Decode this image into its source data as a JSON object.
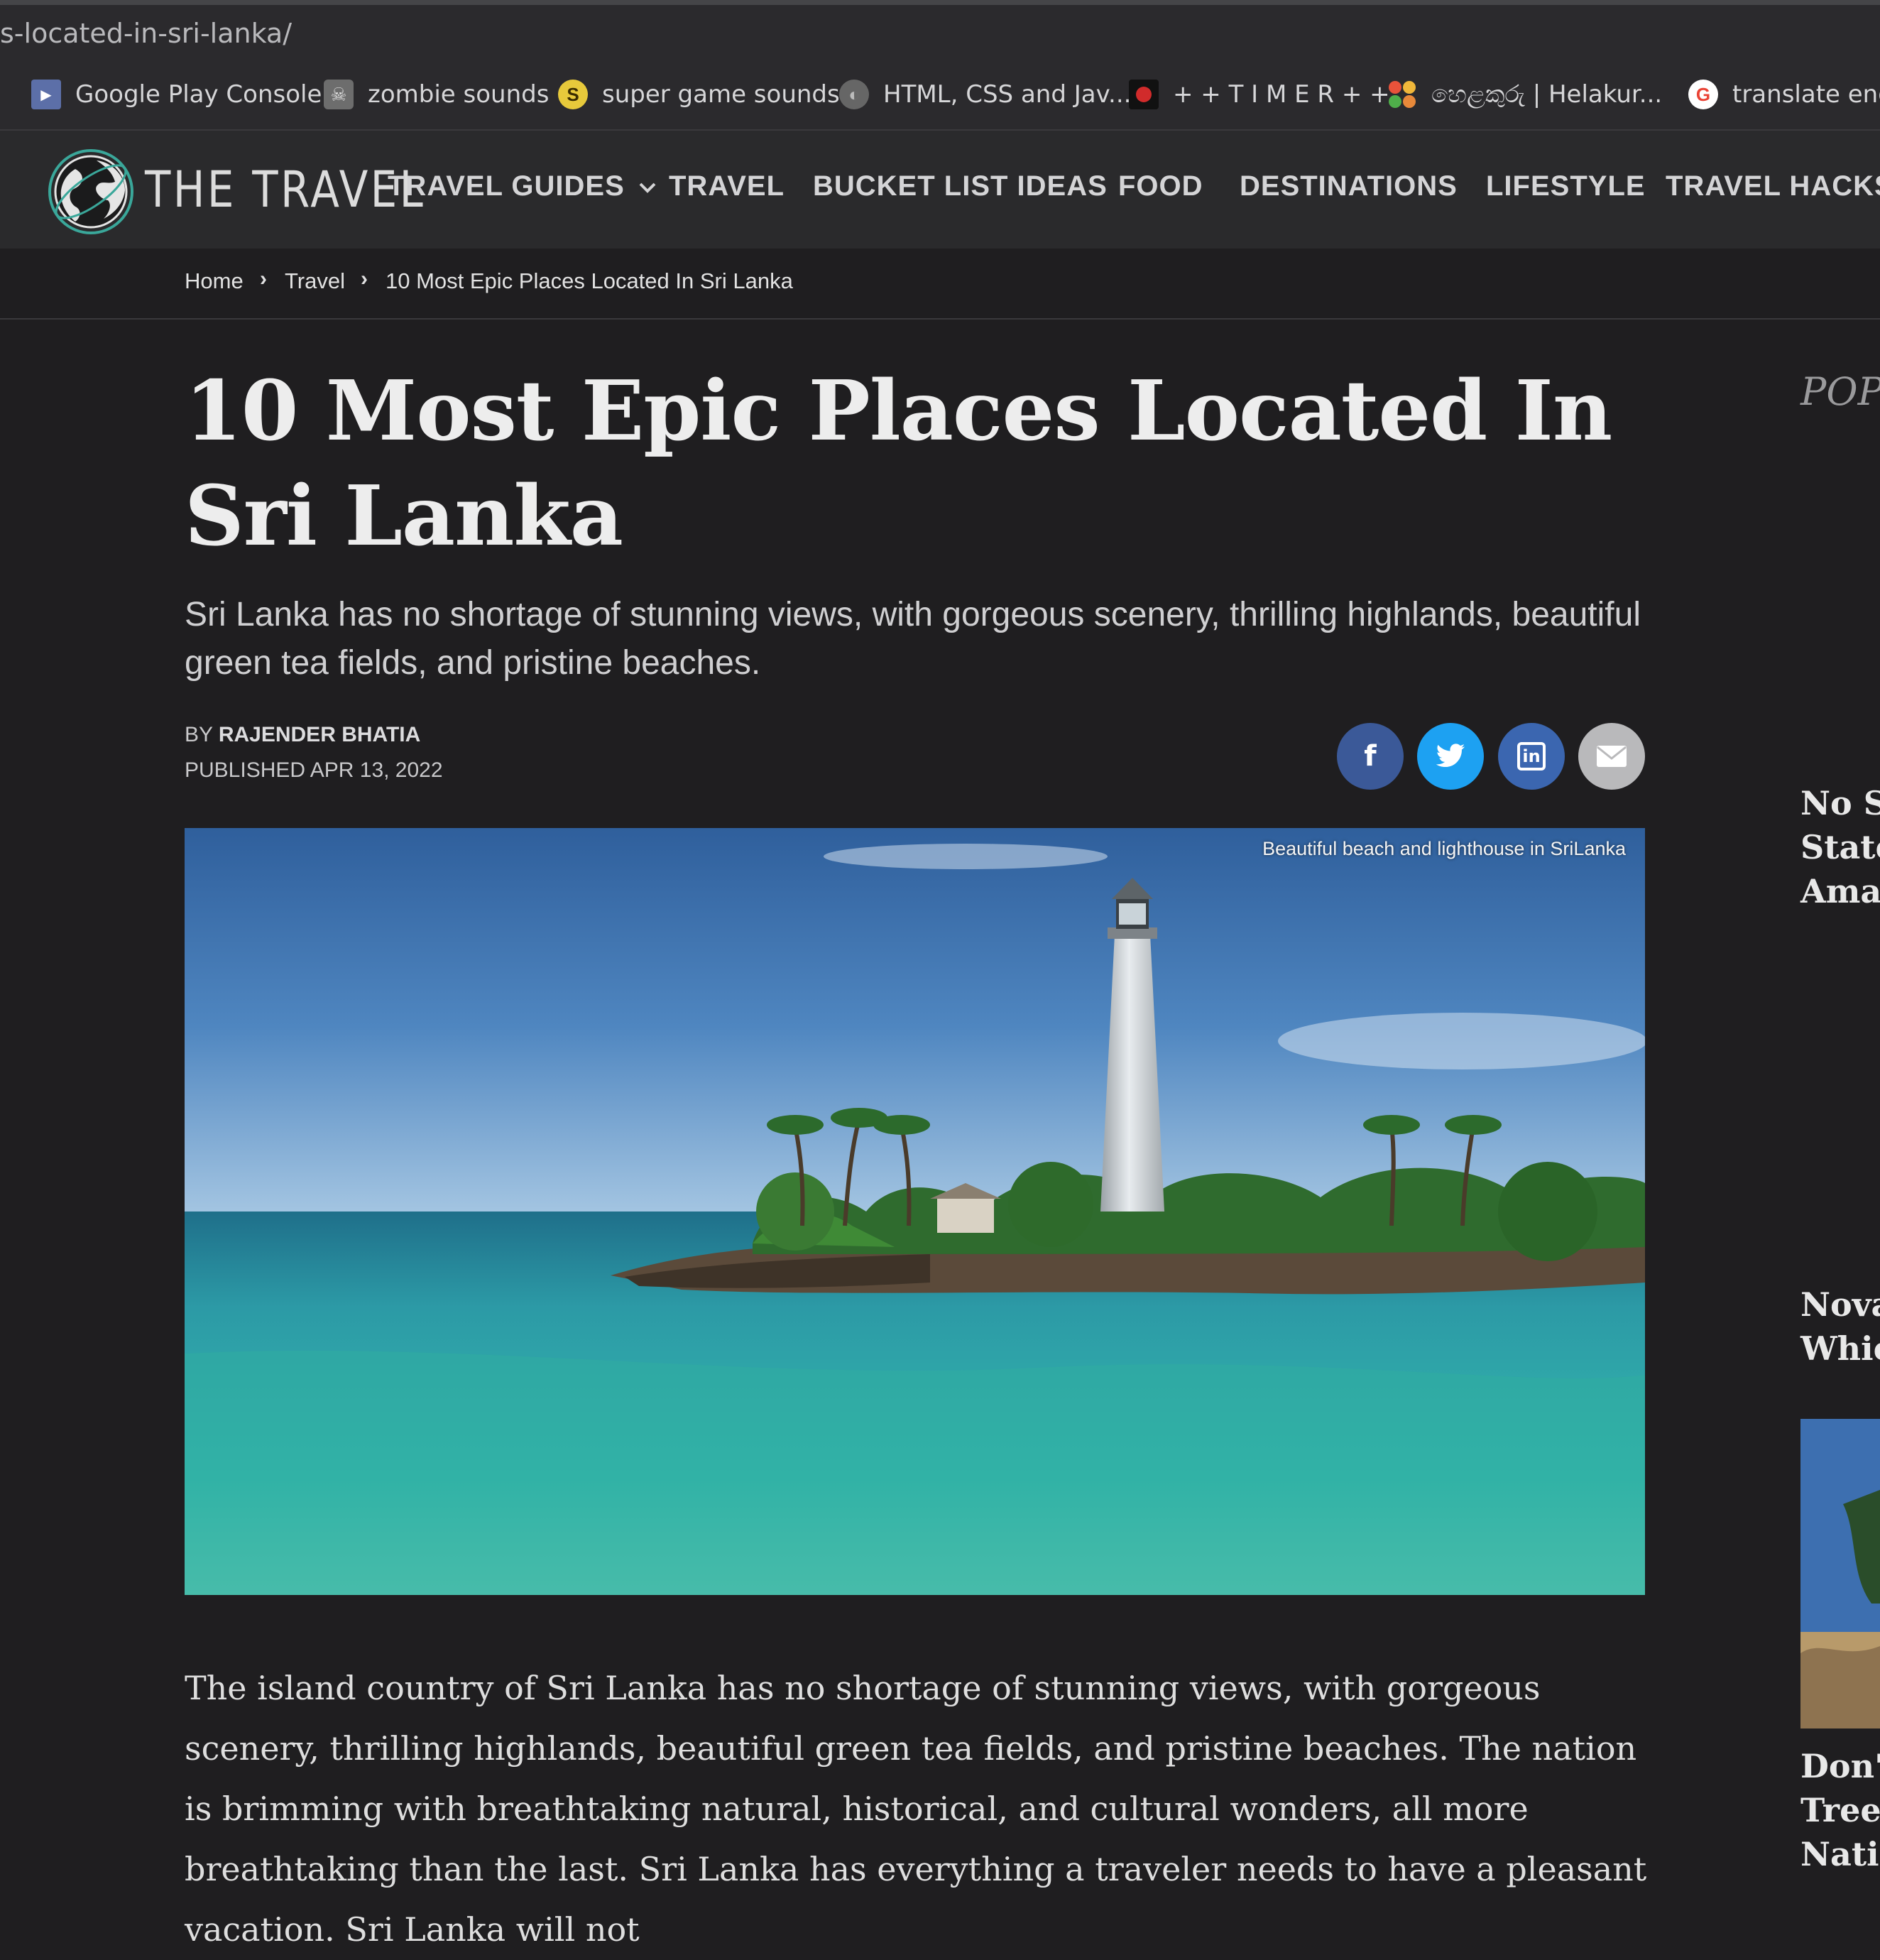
{
  "browser": {
    "url": "s-located-in-sri-lanka/",
    "bookmarks": [
      {
        "label": "Google Play Console",
        "icon": "google-play-console-icon",
        "color": "#6b8ed6"
      },
      {
        "label": "zombie sounds",
        "icon": "zombie-icon",
        "color": "#8a8a8a"
      },
      {
        "label": "super game sounds",
        "icon": "coin-icon",
        "color": "#e7c93b",
        "glyph": "S"
      },
      {
        "label": "HTML, CSS and Jav...",
        "icon": "globe-icon",
        "color": "#777777"
      },
      {
        "label": "+ + T I M E R + +",
        "icon": "timer-icon",
        "color": "#d12b2b"
      },
      {
        "label": "හෙළකුරු | Helakur...",
        "icon": "helakuru-icon",
        "color": "#e0a23a"
      },
      {
        "label": "translate engli",
        "icon": "google-icon",
        "color": "#ea4335",
        "glyph": "G"
      }
    ]
  },
  "site": {
    "logo_text": "THE TRAVEL",
    "nav": [
      "TRAVEL GUIDES",
      "TRAVEL",
      "BUCKET LIST IDEAS",
      "FOOD",
      "DESTINATIONS",
      "LIFESTYLE",
      "TRAVEL HACKS"
    ],
    "nav_dropdown_icon": "chevron-down-icon"
  },
  "breadcrumb": [
    "Home",
    "Travel",
    "10 Most Epic Places Located In Sri Lanka"
  ],
  "article": {
    "title": "10 Most Epic Places Located In Sri Lanka",
    "dek": "Sri Lanka has no shortage of stunning views, with gorgeous scenery, thrilling highlands, beautiful green tea fields, and pristine beaches.",
    "by_prefix": "BY",
    "author": "RAJENDER BHATIA",
    "published": "PUBLISHED APR 13, 2022",
    "share": [
      {
        "network": "facebook",
        "icon": "facebook-icon",
        "glyph": "f",
        "color": "#3b5998"
      },
      {
        "network": "twitter",
        "icon": "twitter-icon",
        "glyph": "t",
        "color": "#1da1f2"
      },
      {
        "network": "linkedin",
        "icon": "linkedin-icon",
        "glyph": "in",
        "color": "#3b66b0"
      },
      {
        "network": "email",
        "icon": "email-icon",
        "glyph": "✉",
        "color": "#b9b9bb"
      }
    ],
    "image_caption": "Beautiful beach and lighthouse in SriLanka",
    "body": "The island country of Sri Lanka has no shortage of stunning views, with gorgeous scenery, thrilling highlands, beautiful green tea fields, and pristine beaches. The nation is brimming with breathtaking natural, historical, and cultural wonders, all more breathtaking than the last. Sri Lanka has everything a traveler needs to have a pleasant vacation. Sri Lanka will not"
  },
  "sidebar": {
    "title": "POP",
    "items": [
      {
        "lines": [
          "No St",
          "State",
          "Amaz"
        ]
      },
      {
        "lines": [
          "Nova",
          "Whic"
        ]
      },
      {
        "lines": [
          "Don't",
          "Tree",
          "Natio"
        ]
      }
    ]
  }
}
